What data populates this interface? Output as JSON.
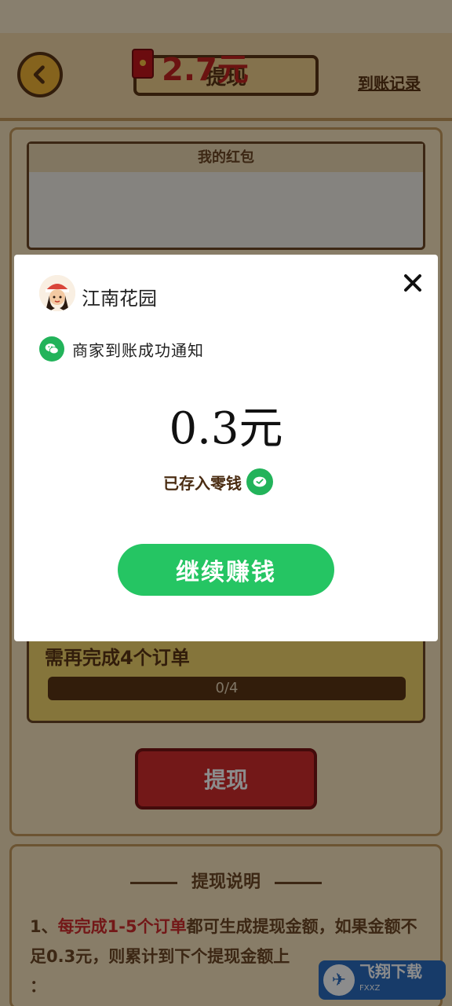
{
  "header": {
    "title": "提现",
    "record_link": "到账记录"
  },
  "red_packet": {
    "heading": "我的红包",
    "amount": "2.7元"
  },
  "progress": {
    "text": "需再完成4个订单",
    "label": "0/4",
    "fraction": 0
  },
  "withdraw_button": "提现",
  "description": {
    "title": "提现说明",
    "line1_prefix": "1、",
    "line1_highlight": "每完成1-5个订单",
    "line1_rest": "都可生成提现金额，如",
    "line2": "果金额不足0.3元，则累计到下个提现金额上",
    "line3": "："
  },
  "modal": {
    "app_name": "江南花园",
    "notice": "商家到账成功通知",
    "amount": "0.3元",
    "saved_text": "已存入零钱",
    "continue_button": "继续赚钱"
  },
  "watermark": {
    "text": "飞翔下载",
    "sub": "FXXZ"
  },
  "colors": {
    "accent_green": "#25c563",
    "red": "#d12c2c",
    "brown": "#5c3514"
  }
}
